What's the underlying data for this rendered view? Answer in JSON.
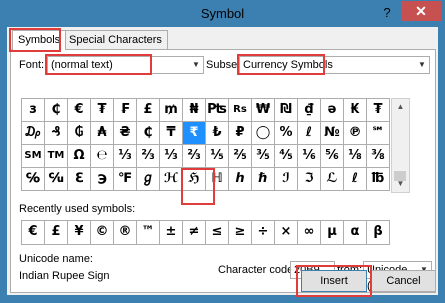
{
  "window": {
    "title": "Symbol",
    "help": "?",
    "close": "✕"
  },
  "tabs": {
    "symbols": "Symbols",
    "special": "Special Characters"
  },
  "font": {
    "label": "Font:",
    "value": "(normal text)"
  },
  "subset": {
    "label": "Subset:",
    "value": "Currency Symbols"
  },
  "grid": [
    [
      "з",
      "₵",
      "€",
      "₮",
      "₣",
      "£",
      "₥",
      "₦",
      "₧",
      "Rs",
      "₩",
      "₪",
      "₫",
      "ә",
      "₭",
      "₮"
    ],
    [
      "₯",
      "₰",
      "₲",
      "₳",
      "₴",
      "₵",
      "₸",
      "₹",
      "₺",
      "₽",
      "◯",
      "%",
      "ℓ",
      "№",
      "℗",
      "℠"
    ],
    [
      "SM",
      "TM",
      "Ω",
      "℮",
      "⅓",
      "⅔",
      "⅓",
      "⅔",
      "⅕",
      "⅖",
      "⅗",
      "⅘",
      "⅙",
      "⅚",
      "⅛",
      "⅜"
    ],
    [
      "℅",
      "℆",
      "ℇ",
      "℈",
      "℉",
      "ℊ",
      "ℋ",
      "ℌ",
      "ℍ",
      "ℎ",
      "ℏ",
      "ℐ",
      "ℑ",
      "ℒ",
      "ℓ",
      "℔"
    ]
  ],
  "grid_row1": [
    "з",
    "₵",
    "€",
    "₮",
    "₣",
    "£",
    "₥",
    "₦",
    "₧",
    "Rs",
    "₩",
    "₪",
    "₫",
    "ә",
    "₭",
    "₮"
  ],
  "selected_symbol": "₹",
  "recent": {
    "label": "Recently used symbols:",
    "items": [
      "€",
      "£",
      "¥",
      "©",
      "®",
      "™",
      "±",
      "≠",
      "≤",
      "≥",
      "÷",
      "×",
      "∞",
      "µ",
      "α",
      "β"
    ]
  },
  "unicode_name": {
    "label": "Unicode name:",
    "value": "Indian Rupee Sign"
  },
  "char_code": {
    "label": "Character code:",
    "value": "20B9"
  },
  "from": {
    "label": "from:",
    "value": "Unicode (hex)"
  },
  "buttons": {
    "insert": "Insert",
    "cancel": "Cancel"
  },
  "colors": {
    "titlebar": "#3c7fb1",
    "selected": "#1e90ff",
    "highlight": "#e03c3c",
    "close": "#c75050"
  }
}
